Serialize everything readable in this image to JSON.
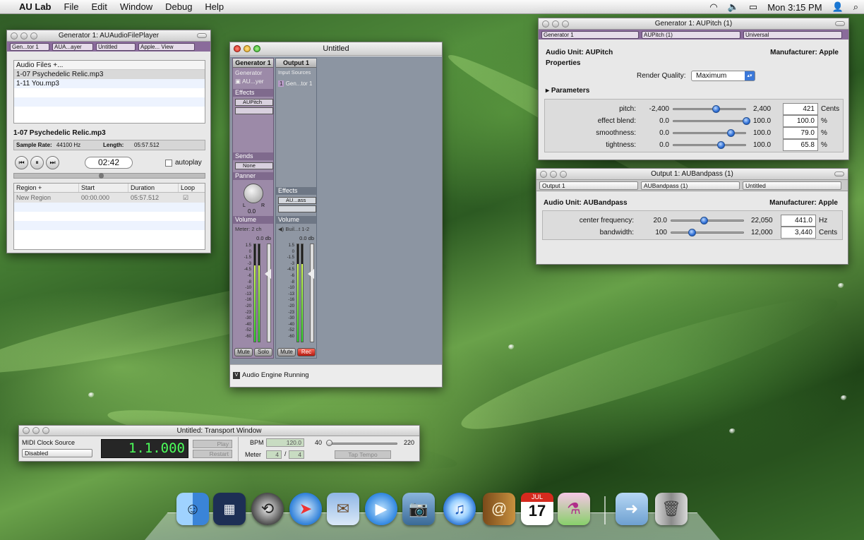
{
  "menubar": {
    "apple": "",
    "app_name": "AU Lab",
    "menus": [
      "File",
      "Edit",
      "Window",
      "Debug",
      "Help"
    ],
    "clock": "Mon 3:15 PM"
  },
  "file_player": {
    "title": "Generator 1: AUAudioFilePlayer",
    "chips": [
      "Gen...tor 1",
      "AUA...ayer",
      "Untitled",
      "Apple... View"
    ],
    "list_header": "Audio Files +...",
    "files": [
      "1-07 Psychedelic Relic.mp3",
      "1-11 You.mp3"
    ],
    "current_file": "1-07 Psychedelic Relic.mp3",
    "sample_rate_label": "Sample Rate:",
    "sample_rate": "44100 Hz",
    "length_label": "Length:",
    "length": "05:57.512",
    "time": "02:42",
    "autoplay_label": "autoplay",
    "region_headers": [
      "Region +",
      "Start",
      "Duration",
      "Loop"
    ],
    "regions": [
      {
        "name": "New Region",
        "start": "00:00.000",
        "duration": "05:57.512"
      }
    ]
  },
  "mixer": {
    "title": "Untitled",
    "gen_strip": {
      "header": "Generator 1",
      "generator_label": "Generator",
      "generator_unit": "AU...yer",
      "effects_label": "Effects",
      "effect_1": "AUPitch",
      "sends_label": "Sends",
      "send": "None",
      "panner_label": "Panner",
      "pan_left": "L",
      "pan_right": "R",
      "pan_value": "0.0",
      "volume_label": "Volume",
      "meter_label": "Meter: 2 ch",
      "db": "0.0 db",
      "mute": "Mute",
      "solo": "Solo"
    },
    "out_strip": {
      "header": "Output 1",
      "input_sources": "Input Sources",
      "source": "Gen...tor 1",
      "effects_label": "Effects",
      "effect_1": "AU...ass",
      "volume_label": "Volume",
      "device": "Buil...t 1-2",
      "db": "0.0 db",
      "mute": "Mute",
      "rec": "Rec"
    },
    "scale": [
      "1.5",
      "0",
      "-1.5",
      "-3",
      "-4.5",
      "-6",
      "-8",
      "-10",
      "-13",
      "-16",
      "-20",
      "-23",
      "-30",
      "-40",
      "-52",
      "-60"
    ],
    "gen_meter_levels": [
      0.78,
      0.78
    ],
    "out_meter_levels": [
      0.8,
      0.8
    ],
    "status": "Audio Engine Running"
  },
  "aupitch": {
    "title": "Generator 1: AUPitch (1)",
    "chips": [
      "Generator 1",
      "AUPitch (1)",
      "Universal"
    ],
    "unit_label": "Audio Unit: AUPitch",
    "manufacturer": "Manufacturer: Apple",
    "properties_label": "Properties",
    "render_quality_label": "Render Quality:",
    "render_quality": "Maximum",
    "parameters_label": "Parameters",
    "params": [
      {
        "name": "pitch:",
        "min": "-2,400",
        "max": "2,400",
        "value": "421",
        "unit": "Cents",
        "fraction": 0.59
      },
      {
        "name": "effect blend:",
        "min": "0.0",
        "max": "100.0",
        "value": "100.0",
        "unit": "%",
        "fraction": 1.0
      },
      {
        "name": "smoothness:",
        "min": "0.0",
        "max": "100.0",
        "value": "79.0",
        "unit": "%",
        "fraction": 0.79
      },
      {
        "name": "tightness:",
        "min": "0.0",
        "max": "100.0",
        "value": "65.8",
        "unit": "%",
        "fraction": 0.658
      }
    ]
  },
  "aubandpass": {
    "title": "Output 1: AUBandpass (1)",
    "chips": [
      "Output 1",
      "AUBandpass (1)",
      "Untitled"
    ],
    "unit_label": "Audio Unit: AUBandpass",
    "manufacturer": "Manufacturer: Apple",
    "params": [
      {
        "name": "center frequency:",
        "min": "20.0",
        "max": "22,050",
        "value": "441.0",
        "unit": "Hz",
        "fraction": 0.45
      },
      {
        "name": "bandwidth:",
        "min": "100",
        "max": "12,000",
        "value": "3,440",
        "unit": "Cents",
        "fraction": 0.29
      }
    ]
  },
  "transport": {
    "title": "Untitled: Transport Window",
    "midi_label": "MIDI Clock Source",
    "midi_value": "Disabled",
    "position": "1.1.000",
    "play": "Play",
    "restart": "Restart",
    "bpm_label": "BPM",
    "bpm": "120.0",
    "bpm_min": "40",
    "bpm_max": "220",
    "meter_label": "Meter",
    "meter_num": "4",
    "meter_sep": "/",
    "meter_den": "4",
    "tap_tempo": "Tap Tempo"
  },
  "dock": {
    "items": [
      "finder-icon",
      "dashboard-icon",
      "time-machine-icon",
      "safari-icon",
      "mail-icon",
      "ichat-icon",
      "iphoto-icon",
      "itunes-icon",
      "address-book-icon",
      "ical-icon",
      "au-lab-icon",
      "downloads-stack-icon",
      "trash-icon"
    ],
    "ical_month": "JUL",
    "ical_day": "17"
  }
}
